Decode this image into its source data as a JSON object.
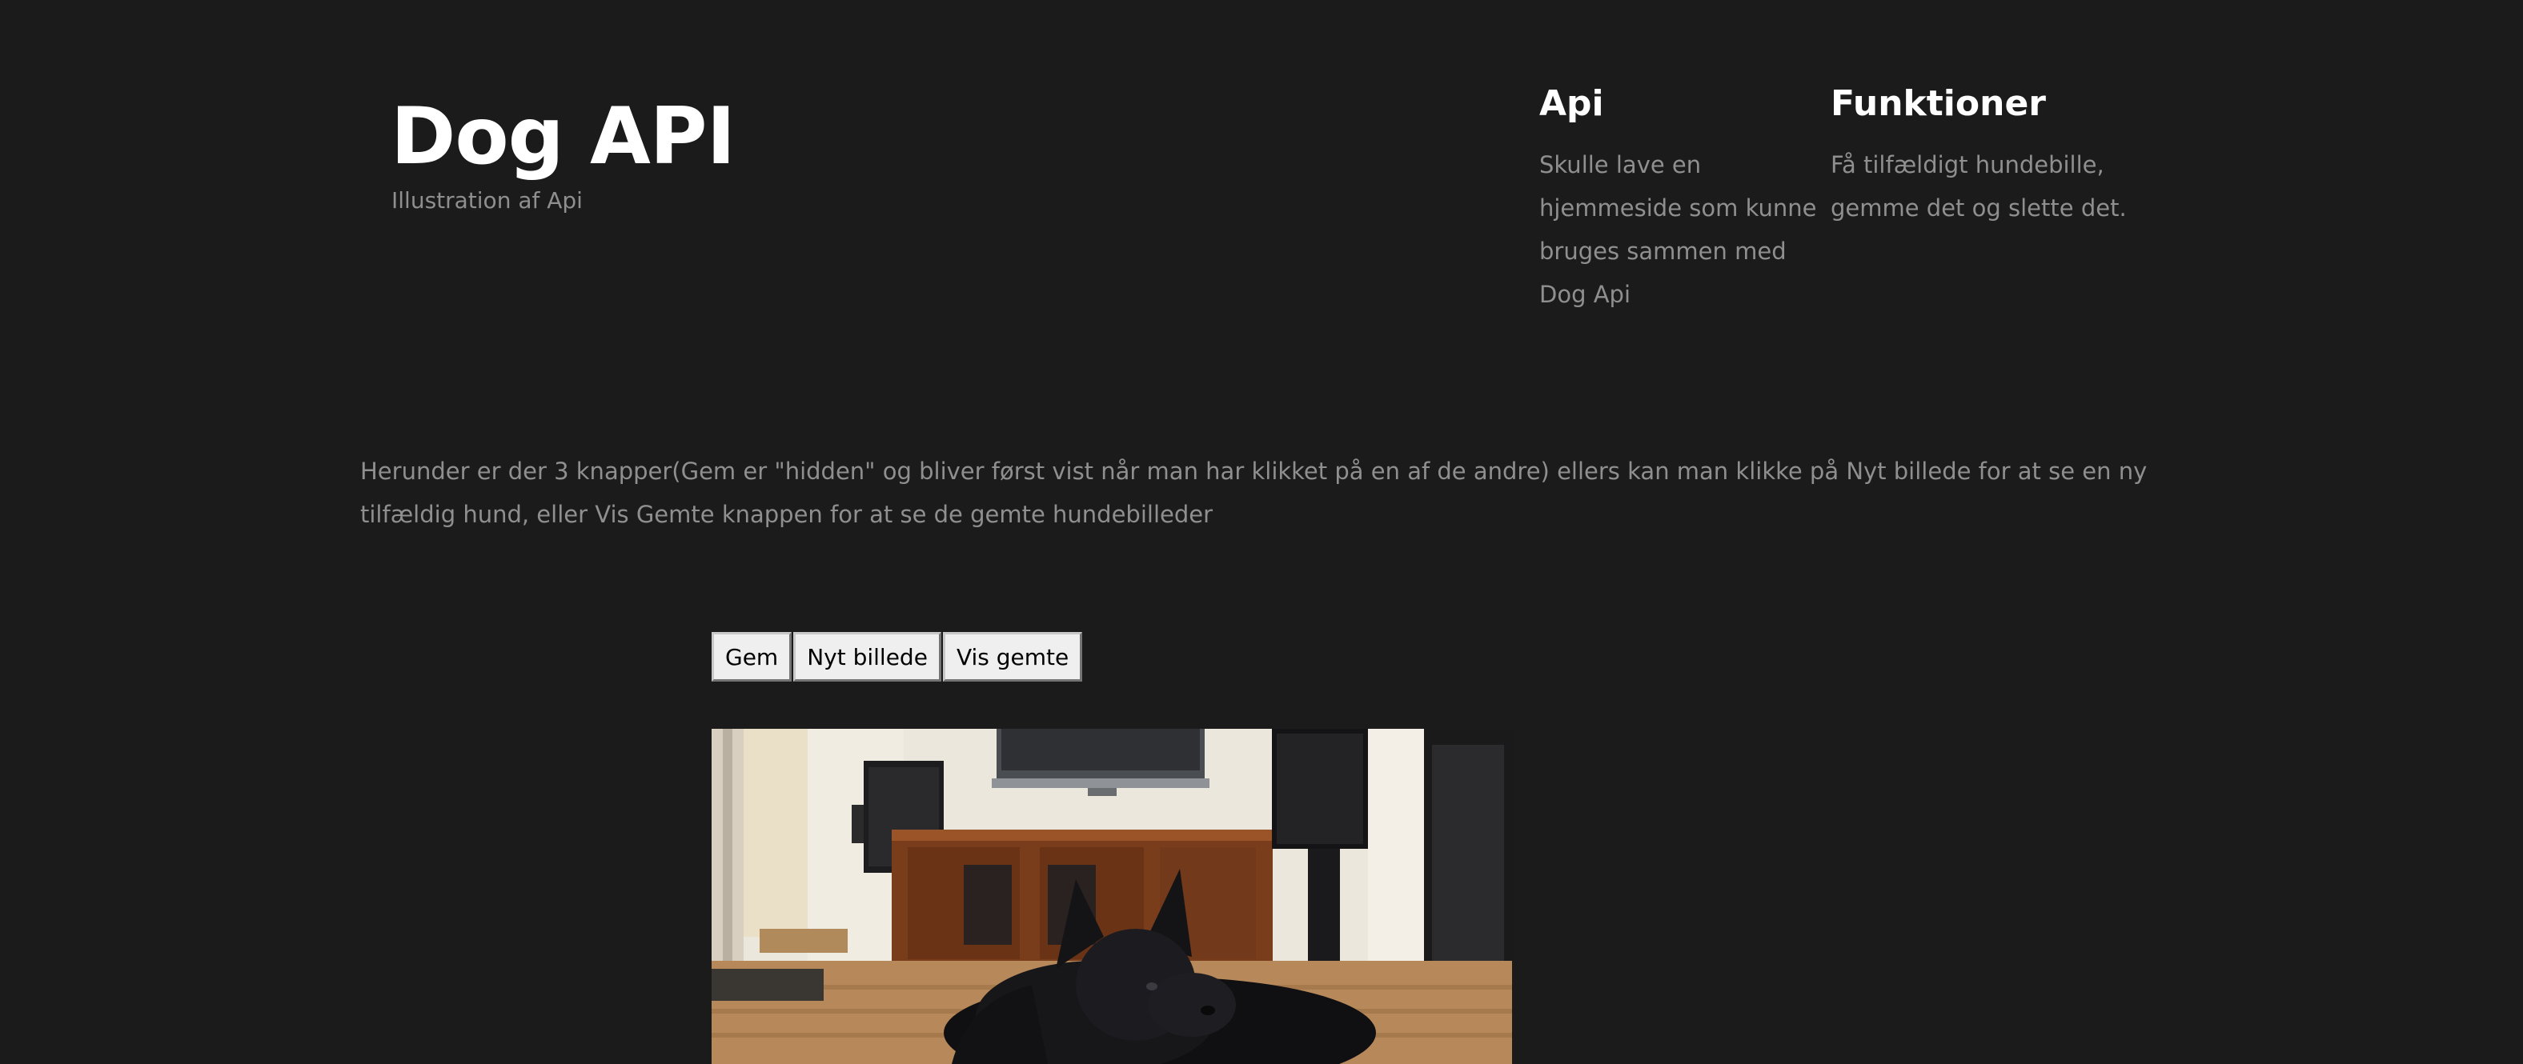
{
  "header": {
    "title": "Dog API",
    "subtitle": "Illustration af Api"
  },
  "info": {
    "api": {
      "heading": "Api",
      "text": "Skulle lave en hjemmeside som kunne bruges sammen med Dog Api"
    },
    "funktioner": {
      "heading": "Funktioner",
      "text": "Få tilfældigt hundebille, gemme det og slette det."
    }
  },
  "intro": {
    "text": "Herunder er der 3 knapper(Gem er \"hidden\" og bliver først vist når man har klikket på en af de andre) ellers kan man klikke på Nyt billede for at se en ny tilfældig hund, eller Vis Gemte knappen for at se de gemte hundebilleder"
  },
  "buttons": {
    "save_label": "Gem",
    "new_label": "Nyt billede",
    "show_saved_label": "Vis gemte"
  },
  "image": {
    "alt": "Tilfældig hund"
  }
}
